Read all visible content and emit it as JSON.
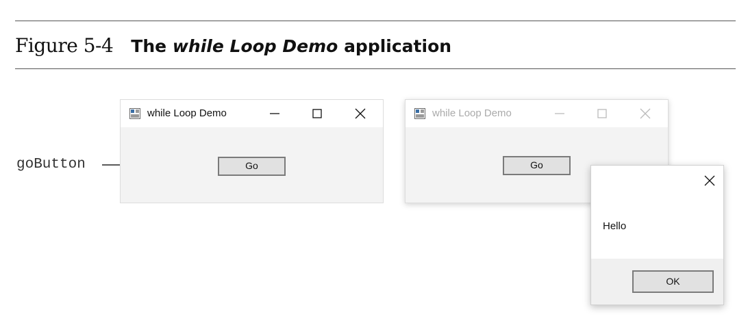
{
  "caption": {
    "figure_label": "Figure 5-4",
    "title_prefix": "The",
    "title_italic": "while Loop Demo",
    "title_suffix": "application"
  },
  "callout": {
    "label": "goButton"
  },
  "window_left": {
    "title": "while Loop Demo",
    "button_label": "Go",
    "icons": [
      "app-icon",
      "minimize-icon",
      "maximize-icon",
      "close-icon"
    ]
  },
  "window_right": {
    "title": "while Loop Demo",
    "button_label": "Go",
    "state": "inactive",
    "icons": [
      "app-icon",
      "minimize-icon",
      "maximize-icon",
      "close-icon"
    ]
  },
  "message_box": {
    "message": "Hello",
    "ok_label": "OK",
    "icons": [
      "close-icon"
    ]
  },
  "colors": {
    "window_client": "#f3f3f3",
    "titlebar": "#ffffff",
    "button_face": "#e1e1e1",
    "inactive_text": "#aaaaaa"
  }
}
